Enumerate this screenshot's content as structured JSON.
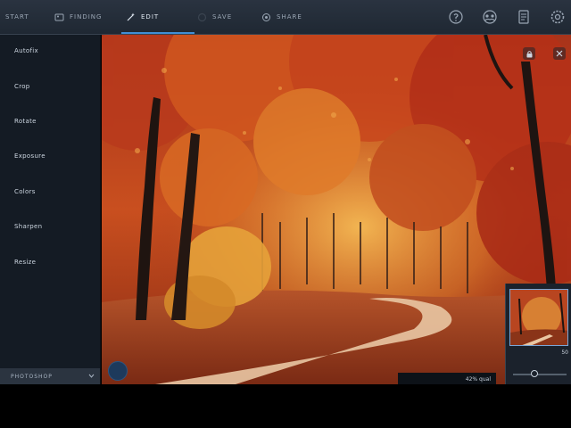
{
  "toolbar": {
    "tabs": [
      {
        "label": "START",
        "icon": "none"
      },
      {
        "label": "FINDING",
        "icon": "picture-icon"
      },
      {
        "label": "EDIT",
        "icon": "magic-wand-icon",
        "active": true
      },
      {
        "label": "SAVE",
        "icon": "save-icon"
      },
      {
        "label": "SHARE",
        "icon": "share-icon"
      }
    ],
    "right_icons": [
      "help-icon",
      "community-icon",
      "document-icon",
      "settings-icon"
    ]
  },
  "sidebar": {
    "items": [
      "Autofix",
      "Crop",
      "Rotate",
      "Exposure",
      "Colors",
      "Sharpen",
      "Resize"
    ],
    "dropdown_label": "PHOTOSHOP",
    "accent": "#3f8fd6"
  },
  "status": {
    "zoom_label": "42% qual"
  },
  "navigator": {
    "value": "50"
  }
}
